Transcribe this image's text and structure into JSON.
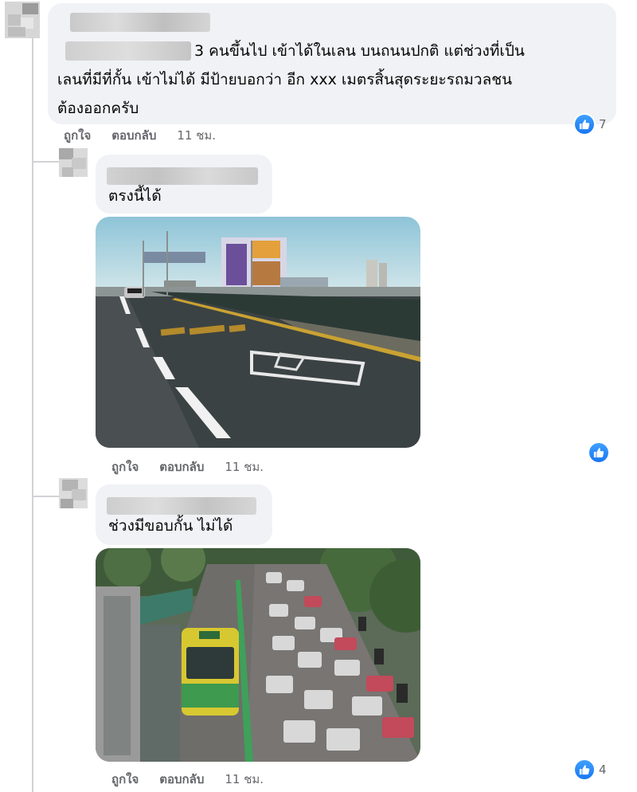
{
  "comments": [
    {
      "text": "3 คนขึ้นไป เข้าได้ในเลน บนถนนปกติ แต่ช่วงที่เป็น\nเลนที่มีที่กั้น เข้าไม่ได้ มีป้ายบอกว่า อีก xxx เมตรสิ้นสุดระยะรถมวลชน\nต้องออกครับ",
      "actions": {
        "like": "ถูกใจ",
        "reply": "ตอบกลับ",
        "time": "11 ชม."
      },
      "reaction_count": "7"
    },
    {
      "text": "ตรงนี้ได้",
      "actions": {
        "like": "ถูกใจ",
        "reply": "ตอบกลับ",
        "time": "11 ชม."
      },
      "reaction_count": ""
    },
    {
      "text": "ช่วงมีขอบกั้น ไม่ได้",
      "actions": {
        "like": "ถูกใจ",
        "reply": "ตอบกลับ",
        "time": "11 ชม."
      },
      "reaction_count": "4"
    }
  ],
  "colors": {
    "like_blue": "#1877f2",
    "bubble": "#f0f2f5",
    "meta_text": "#65676b"
  },
  "icons": {
    "reaction": "like-thumb-icon"
  }
}
